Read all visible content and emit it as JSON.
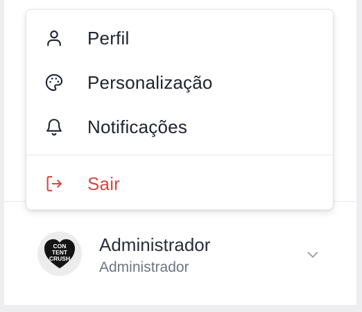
{
  "menu": {
    "items": [
      {
        "label": "Perfil",
        "icon": "user-icon"
      },
      {
        "label": "Personalização",
        "icon": "palette-icon"
      },
      {
        "label": "Notificações",
        "icon": "bell-icon"
      }
    ],
    "logout": {
      "label": "Sair",
      "icon": "logout-icon",
      "color": "#d9463e"
    }
  },
  "user": {
    "name": "Administrador",
    "role": "Administrador",
    "avatar_text": [
      "CON",
      "TENT",
      "CRUSH"
    ]
  },
  "colors": {
    "text": "#1f2230",
    "danger": "#d9463e",
    "muted": "#707380"
  }
}
